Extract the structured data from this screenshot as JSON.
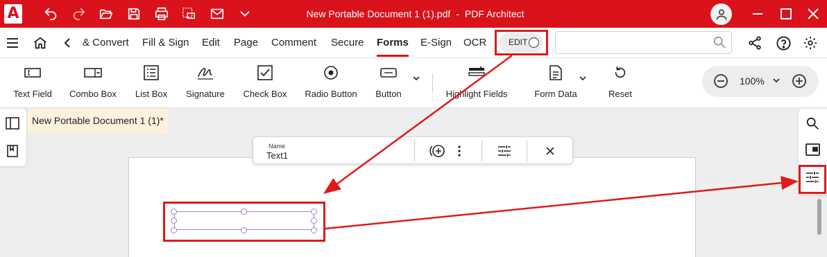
{
  "app": {
    "logo_letter": "A",
    "document_title": "New Portable Document 1 (1).pdf",
    "separator": "-",
    "app_name": "PDF Architect",
    "brand_color": "#d9121b"
  },
  "menu": {
    "items": [
      "& Convert",
      "Fill & Sign",
      "Edit",
      "Page",
      "Comment",
      "Secure",
      "Forms",
      "E-Sign",
      "OCR"
    ],
    "active": "Forms",
    "edit_toggle_label": "EDIT",
    "search_placeholder": ""
  },
  "toolbar": {
    "tools": [
      {
        "label": "Text Field",
        "icon": "text-field-icon"
      },
      {
        "label": "Combo Box",
        "icon": "combo-box-icon"
      },
      {
        "label": "List Box",
        "icon": "list-box-icon"
      },
      {
        "label": "Signature",
        "icon": "signature-icon"
      },
      {
        "label": "Check Box",
        "icon": "check-box-icon"
      },
      {
        "label": "Radio Button",
        "icon": "radio-button-icon"
      },
      {
        "label": "Button",
        "icon": "button-icon"
      },
      {
        "label": "Highlight Fields",
        "icon": "highlight-fields-icon"
      },
      {
        "label": "Form Data",
        "icon": "form-data-icon"
      },
      {
        "label": "Reset",
        "icon": "reset-icon"
      }
    ],
    "zoom": "100%"
  },
  "document": {
    "tab_label": "New Portable Document 1 (1)*"
  },
  "field_toolbar": {
    "name_label": "Name",
    "name_value": "Text1"
  },
  "annotation": {
    "highlight_color": "#e11919"
  }
}
